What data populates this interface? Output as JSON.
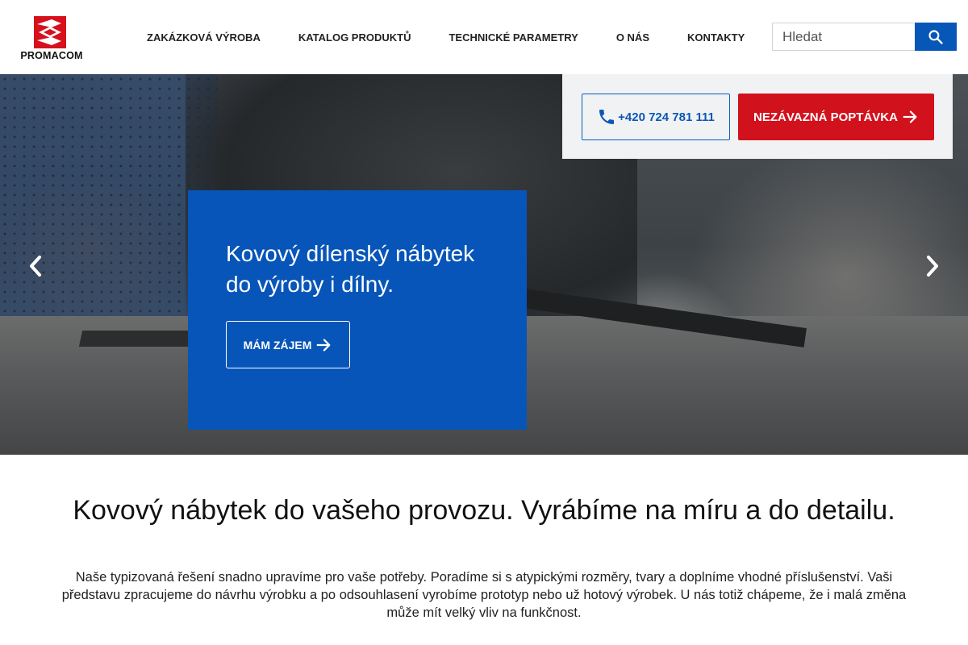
{
  "header": {
    "logo_text": "PROMACOM",
    "nav": [
      {
        "label": "ZAKÁZKOVÁ VÝROBA"
      },
      {
        "label": "KATALOG PRODUKTŮ"
      },
      {
        "label": "TECHNICKÉ PARAMETRY"
      },
      {
        "label": "O NÁS"
      },
      {
        "label": "KONTAKTY"
      }
    ],
    "search": {
      "placeholder": "Hledat",
      "icon": "search-icon"
    }
  },
  "contact": {
    "phone_label": "+420 724 781 111",
    "phone_icon": "phone-icon",
    "inquiry_label": "NEZÁVAZNÁ POPTÁVKA",
    "inquiry_icon": "arrow-right-icon"
  },
  "hero": {
    "heading": "Kovový dílenský nábytek do výroby i dílny.",
    "cta_label": "MÁM ZÁJEM",
    "prev_icon": "chevron-left-icon",
    "next_icon": "chevron-right-icon"
  },
  "content": {
    "title": "Kovový nábytek do vašeho provozu. Vyrábíme na míru a do detailu.",
    "body": "Naše typizovaná řešení snadno upravíme pro vaše potřeby. Poradíme si s atypickými rozměry, tvary a doplníme vhodné příslušenství. Vaši představu zpracujeme do návrhu výrobku a po odsouhlasení vyrobíme prototyp nebo už hotový výrobek. U nás totiž chápeme, že i malá změna může mít velký vliv na funkčnost."
  },
  "colors": {
    "brand_blue": "#0755b8",
    "brand_red": "#d1111c",
    "logo_red": "#d6111d"
  }
}
